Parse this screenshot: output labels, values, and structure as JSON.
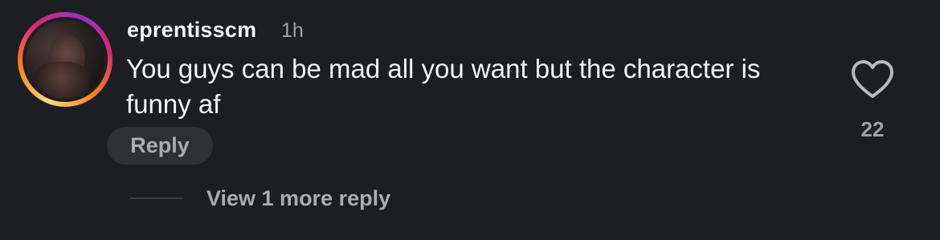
{
  "comment": {
    "username": "eprentisscm",
    "timestamp": "1h",
    "text": "You guys can be mad all you want but the character is funny af",
    "reply_label": "Reply",
    "like_count": "22",
    "view_replies_label": "View 1 more reply"
  },
  "icons": {
    "like": "heart-outline-icon",
    "avatar": "avatar-with-story-ring"
  },
  "colors": {
    "background": "#1c1e21",
    "text_primary": "#f5f6f7",
    "text_secondary": "#9ea2a8",
    "reply_button_bg": "#2e3035"
  }
}
